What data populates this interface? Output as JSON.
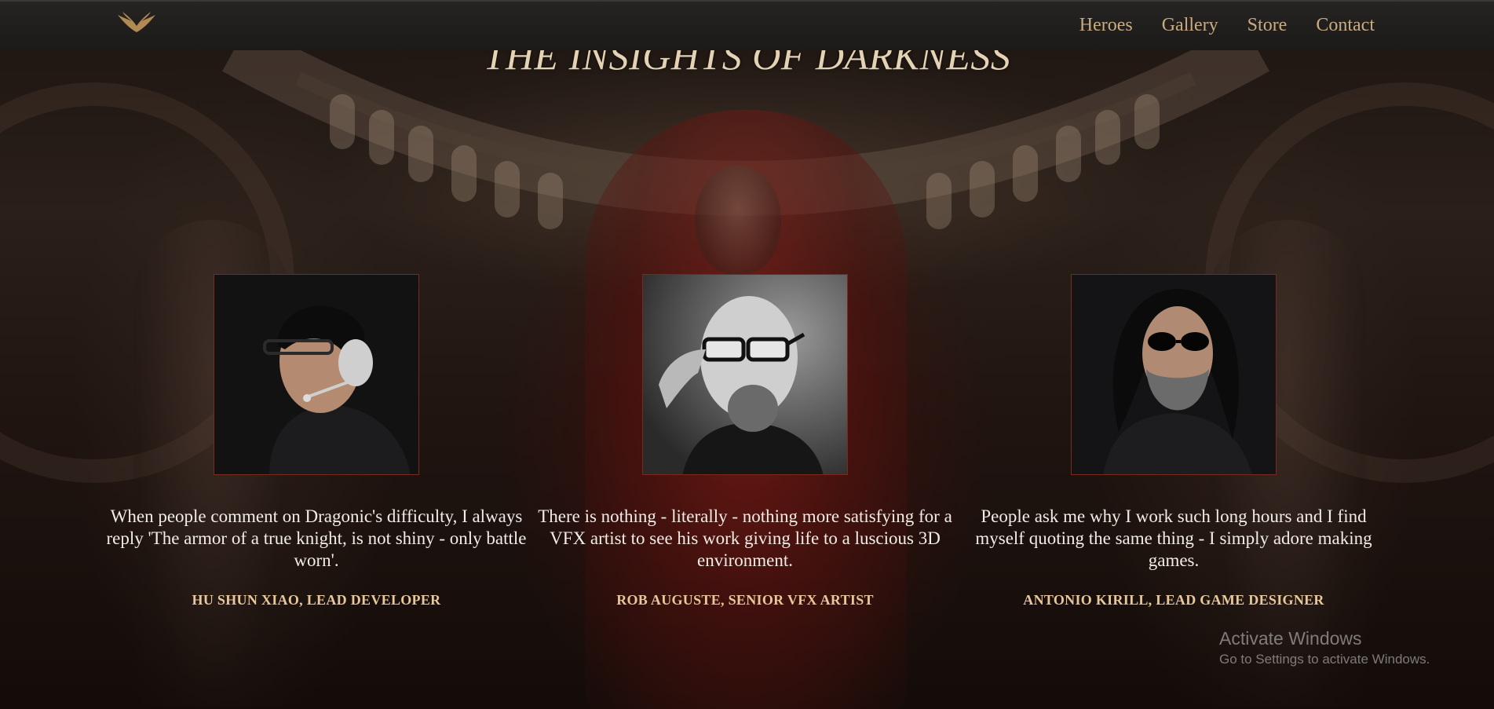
{
  "nav": {
    "logo": "winged-logo-icon",
    "links": [
      "Heroes",
      "Gallery",
      "Store",
      "Contact"
    ]
  },
  "page": {
    "title": "THE INSIGHTS OF DARKNESS"
  },
  "team": [
    {
      "quote": "When people comment on Dragonic's difficulty, I always reply 'The armor of a true knight, is not shiny - only battle worn'.",
      "author": "HU SHUN XIAO, LEAD DEVELOPER",
      "photo": "portrait-headset-developer"
    },
    {
      "quote": "There is nothing - literally - nothing more satisfying for a VFX artist to see his work giving life to a luscious 3D environment.",
      "author": "ROB AUGUSTE, SENIOR VFX ARTIST",
      "photo": "portrait-bald-glasses-artist"
    },
    {
      "quote": "People ask me why I work such long hours and I find myself quoting the same thing - I simply adore making games.",
      "author": "ANTONIO KIRILL, LEAD GAME DESIGNER",
      "photo": "portrait-long-hair-sunglasses-designer"
    }
  ],
  "watermark": {
    "title": "Activate Windows",
    "subtitle": "Go to Settings to activate Windows."
  },
  "colors": {
    "nav_link": "#c9ab82",
    "title": "#e3d2b4",
    "author": "#e8c79a",
    "photo_border": "#7a2a1c"
  }
}
